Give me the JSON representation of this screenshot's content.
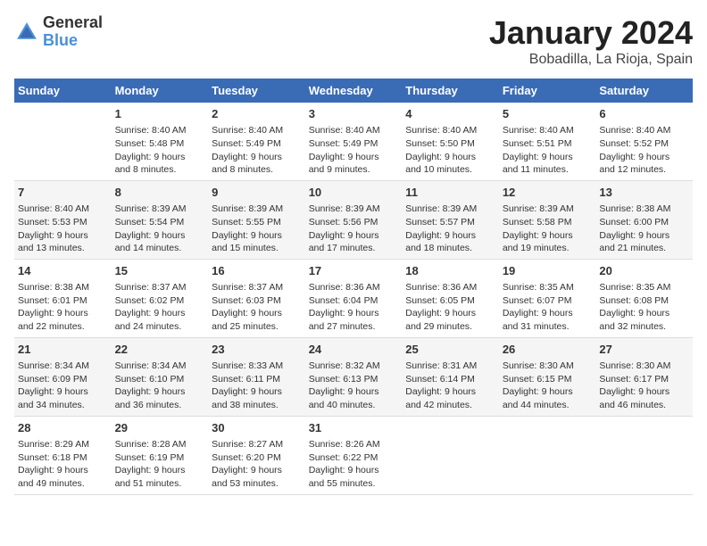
{
  "header": {
    "logo_general": "General",
    "logo_blue": "Blue",
    "month_title": "January 2024",
    "location": "Bobadilla, La Rioja, Spain"
  },
  "weekdays": [
    "Sunday",
    "Monday",
    "Tuesday",
    "Wednesday",
    "Thursday",
    "Friday",
    "Saturday"
  ],
  "weeks": [
    [
      {
        "day": "",
        "lines": []
      },
      {
        "day": "1",
        "lines": [
          "Sunrise: 8:40 AM",
          "Sunset: 5:48 PM",
          "Daylight: 9 hours",
          "and 8 minutes."
        ]
      },
      {
        "day": "2",
        "lines": [
          "Sunrise: 8:40 AM",
          "Sunset: 5:49 PM",
          "Daylight: 9 hours",
          "and 8 minutes."
        ]
      },
      {
        "day": "3",
        "lines": [
          "Sunrise: 8:40 AM",
          "Sunset: 5:49 PM",
          "Daylight: 9 hours",
          "and 9 minutes."
        ]
      },
      {
        "day": "4",
        "lines": [
          "Sunrise: 8:40 AM",
          "Sunset: 5:50 PM",
          "Daylight: 9 hours",
          "and 10 minutes."
        ]
      },
      {
        "day": "5",
        "lines": [
          "Sunrise: 8:40 AM",
          "Sunset: 5:51 PM",
          "Daylight: 9 hours",
          "and 11 minutes."
        ]
      },
      {
        "day": "6",
        "lines": [
          "Sunrise: 8:40 AM",
          "Sunset: 5:52 PM",
          "Daylight: 9 hours",
          "and 12 minutes."
        ]
      }
    ],
    [
      {
        "day": "7",
        "lines": [
          "Sunrise: 8:40 AM",
          "Sunset: 5:53 PM",
          "Daylight: 9 hours",
          "and 13 minutes."
        ]
      },
      {
        "day": "8",
        "lines": [
          "Sunrise: 8:39 AM",
          "Sunset: 5:54 PM",
          "Daylight: 9 hours",
          "and 14 minutes."
        ]
      },
      {
        "day": "9",
        "lines": [
          "Sunrise: 8:39 AM",
          "Sunset: 5:55 PM",
          "Daylight: 9 hours",
          "and 15 minutes."
        ]
      },
      {
        "day": "10",
        "lines": [
          "Sunrise: 8:39 AM",
          "Sunset: 5:56 PM",
          "Daylight: 9 hours",
          "and 17 minutes."
        ]
      },
      {
        "day": "11",
        "lines": [
          "Sunrise: 8:39 AM",
          "Sunset: 5:57 PM",
          "Daylight: 9 hours",
          "and 18 minutes."
        ]
      },
      {
        "day": "12",
        "lines": [
          "Sunrise: 8:39 AM",
          "Sunset: 5:58 PM",
          "Daylight: 9 hours",
          "and 19 minutes."
        ]
      },
      {
        "day": "13",
        "lines": [
          "Sunrise: 8:38 AM",
          "Sunset: 6:00 PM",
          "Daylight: 9 hours",
          "and 21 minutes."
        ]
      }
    ],
    [
      {
        "day": "14",
        "lines": [
          "Sunrise: 8:38 AM",
          "Sunset: 6:01 PM",
          "Daylight: 9 hours",
          "and 22 minutes."
        ]
      },
      {
        "day": "15",
        "lines": [
          "Sunrise: 8:37 AM",
          "Sunset: 6:02 PM",
          "Daylight: 9 hours",
          "and 24 minutes."
        ]
      },
      {
        "day": "16",
        "lines": [
          "Sunrise: 8:37 AM",
          "Sunset: 6:03 PM",
          "Daylight: 9 hours",
          "and 25 minutes."
        ]
      },
      {
        "day": "17",
        "lines": [
          "Sunrise: 8:36 AM",
          "Sunset: 6:04 PM",
          "Daylight: 9 hours",
          "and 27 minutes."
        ]
      },
      {
        "day": "18",
        "lines": [
          "Sunrise: 8:36 AM",
          "Sunset: 6:05 PM",
          "Daylight: 9 hours",
          "and 29 minutes."
        ]
      },
      {
        "day": "19",
        "lines": [
          "Sunrise: 8:35 AM",
          "Sunset: 6:07 PM",
          "Daylight: 9 hours",
          "and 31 minutes."
        ]
      },
      {
        "day": "20",
        "lines": [
          "Sunrise: 8:35 AM",
          "Sunset: 6:08 PM",
          "Daylight: 9 hours",
          "and 32 minutes."
        ]
      }
    ],
    [
      {
        "day": "21",
        "lines": [
          "Sunrise: 8:34 AM",
          "Sunset: 6:09 PM",
          "Daylight: 9 hours",
          "and 34 minutes."
        ]
      },
      {
        "day": "22",
        "lines": [
          "Sunrise: 8:34 AM",
          "Sunset: 6:10 PM",
          "Daylight: 9 hours",
          "and 36 minutes."
        ]
      },
      {
        "day": "23",
        "lines": [
          "Sunrise: 8:33 AM",
          "Sunset: 6:11 PM",
          "Daylight: 9 hours",
          "and 38 minutes."
        ]
      },
      {
        "day": "24",
        "lines": [
          "Sunrise: 8:32 AM",
          "Sunset: 6:13 PM",
          "Daylight: 9 hours",
          "and 40 minutes."
        ]
      },
      {
        "day": "25",
        "lines": [
          "Sunrise: 8:31 AM",
          "Sunset: 6:14 PM",
          "Daylight: 9 hours",
          "and 42 minutes."
        ]
      },
      {
        "day": "26",
        "lines": [
          "Sunrise: 8:30 AM",
          "Sunset: 6:15 PM",
          "Daylight: 9 hours",
          "and 44 minutes."
        ]
      },
      {
        "day": "27",
        "lines": [
          "Sunrise: 8:30 AM",
          "Sunset: 6:17 PM",
          "Daylight: 9 hours",
          "and 46 minutes."
        ]
      }
    ],
    [
      {
        "day": "28",
        "lines": [
          "Sunrise: 8:29 AM",
          "Sunset: 6:18 PM",
          "Daylight: 9 hours",
          "and 49 minutes."
        ]
      },
      {
        "day": "29",
        "lines": [
          "Sunrise: 8:28 AM",
          "Sunset: 6:19 PM",
          "Daylight: 9 hours",
          "and 51 minutes."
        ]
      },
      {
        "day": "30",
        "lines": [
          "Sunrise: 8:27 AM",
          "Sunset: 6:20 PM",
          "Daylight: 9 hours",
          "and 53 minutes."
        ]
      },
      {
        "day": "31",
        "lines": [
          "Sunrise: 8:26 AM",
          "Sunset: 6:22 PM",
          "Daylight: 9 hours",
          "and 55 minutes."
        ]
      },
      {
        "day": "",
        "lines": []
      },
      {
        "day": "",
        "lines": []
      },
      {
        "day": "",
        "lines": []
      }
    ]
  ]
}
